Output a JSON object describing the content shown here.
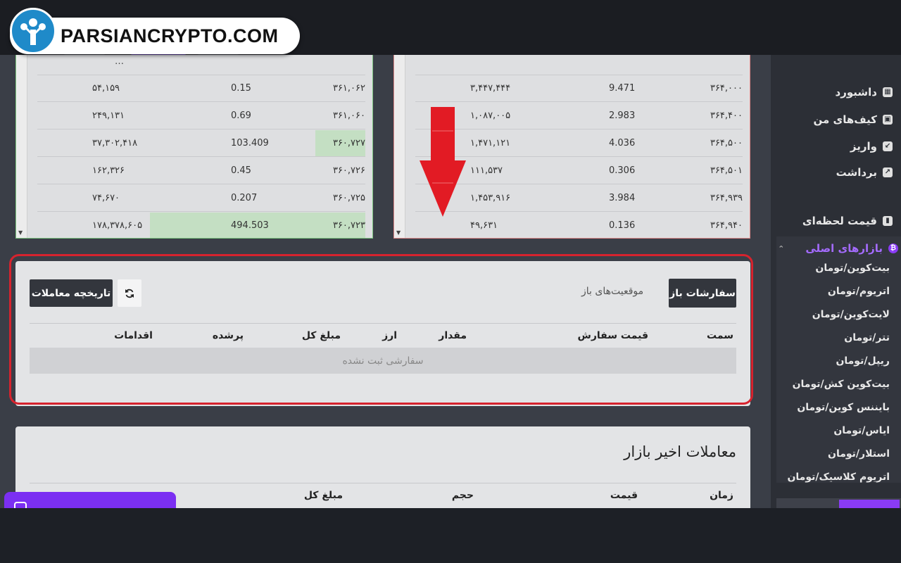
{
  "watermark": {
    "text": "PARSIANCRYPTO.COM"
  },
  "sidebar": {
    "items": [
      {
        "label": "داشبورد",
        "icon": "dashboard-icon"
      },
      {
        "label": "کیف‌های من",
        "icon": "wallet-icon"
      },
      {
        "label": "واریز",
        "icon": "deposit-icon"
      },
      {
        "label": "برداشت",
        "icon": "withdraw-icon"
      }
    ],
    "live_price": "قیمت لحظه‌ای",
    "main_markets": "بازارهای اصلی",
    "markets": [
      "بیت‌کوین/تومان",
      "اتریوم/تومان",
      "لایت‌کوین/تومان",
      "تتر/تومان",
      "ریپل/تومان",
      "بیت‌کوین کش/تومان",
      "بایننس کوین/تومان",
      "ایاس/تومان",
      "استلار/تومان",
      "اتریوم کلاسیک/تومان"
    ],
    "accent_color": "#8a3bf5"
  },
  "order_book": {
    "buy_rows": [
      {
        "total": "۵۴,۱۵۹",
        "amount": "0.15",
        "price": "۳۶۱,۰۶۲"
      },
      {
        "total": "۲۴۹,۱۳۱",
        "amount": "0.69",
        "price": "۳۶۱,۰۶۰"
      },
      {
        "total": "۳۷,۳۰۲,۴۱۸",
        "amount": "103.409",
        "price": "۳۶۰,۷۲۷"
      },
      {
        "total": "۱۶۲,۳۲۶",
        "amount": "0.45",
        "price": "۳۶۰,۷۲۶"
      },
      {
        "total": "۷۴,۶۷۰",
        "amount": "0.207",
        "price": "۳۶۰,۷۲۵"
      },
      {
        "total": "۱۷۸,۳۷۸,۶۰۵",
        "amount": "494.503",
        "price": "۳۶۰,۷۲۳"
      }
    ],
    "sell_rows": [
      {
        "total": "۳,۴۴۷,۴۴۴",
        "amount": "9.471",
        "price": "۳۶۴,۰۰۰"
      },
      {
        "total": "۱,۰۸۷,۰۰۵",
        "amount": "2.983",
        "price": "۳۶۴,۴۰۰"
      },
      {
        "total": "۱,۴۷۱,۱۲۱",
        "amount": "4.036",
        "price": "۳۶۴,۵۰۰"
      },
      {
        "total": "۱۱۱,۵۳۷",
        "amount": "0.306",
        "price": "۳۶۴,۵۰۱"
      },
      {
        "total": "۱,۴۵۳,۹۱۶",
        "amount": "3.984",
        "price": "۳۶۴,۹۳۹"
      },
      {
        "total": "۴۹,۶۳۱",
        "amount": "0.136",
        "price": "۳۶۴,۹۴۰"
      }
    ],
    "buy_color": "#7bc47f",
    "sell_color": "#e08a8a"
  },
  "open_orders": {
    "tab_open": "سفارشات باز",
    "tab_positions": "موقعیت‌های باز",
    "history_button": "تاریخچه معاملات",
    "refresh_icon": "refresh-icon",
    "columns": {
      "side": "سمت",
      "order_price": "قیمت سفارش",
      "amount": "مقدار",
      "currency": "ارز",
      "total": "مبلغ کل",
      "filled": "پرشده",
      "actions": "اقدامات"
    },
    "empty_text": "سفارشی ثبت نشده",
    "highlight_color": "#d6232e"
  },
  "recent_trades": {
    "title": "معاملات اخیر بازار",
    "columns": {
      "time": "زمان",
      "price": "قیمت",
      "volume": "حجم",
      "total": "مبلغ کل"
    }
  },
  "chat_widget": {
    "icon": "chat-icon",
    "color": "#7b2ff2"
  }
}
